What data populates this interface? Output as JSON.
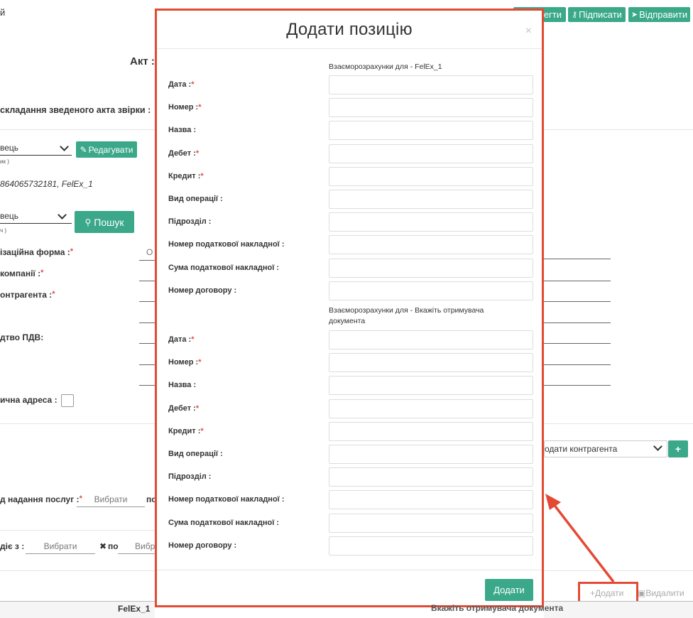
{
  "header": {
    "partial_left": "й",
    "partial_btn1": "егти",
    "sign_label": "Підписати",
    "send_label": "Відправити",
    "act_title": "Акт :"
  },
  "form": {
    "compile_label": "складання зведеного акта звірки :",
    "party_select_value": "вець",
    "party_select_hint": "ик )",
    "edit_label": "Редагувати",
    "org_info": "864065732181, FelEx_1",
    "party2_select_value": "вець",
    "party2_select_hint": "ч )",
    "search_label": "Пошук",
    "org_form_label": "ізаційна форма :",
    "org_form_value_partial": "О",
    "company_label": "компанії :",
    "contragent_label": "онтрагента :",
    "vat_label": "дтво ПДВ:",
    "address_label": "ична адреса :",
    "add_contragent_placeholder": "одати контрагента",
    "services_period_label": "д надання послуг :",
    "pick_placeholder": "Вибрати",
    "to_label_partial": "по",
    "valid_from_label": "діє з :",
    "valid_to_label": "по",
    "pick_partial": "Вибр",
    "add_link": "Додати",
    "delete_link": "Видалити"
  },
  "table": {
    "left_header": "FelEx_1",
    "right_header": "Вкажіть отримувача документа"
  },
  "modal": {
    "title": "Додати позицію",
    "close_icon": "×",
    "section1_title": "Взаєморозрахунки для - FelEx_1",
    "section2_title": "Взаєморозрахунки для - Вкажіть отримувача документа",
    "fields1": [
      {
        "label": "Дата :",
        "required": "*"
      },
      {
        "label": "Номер :",
        "required": "*"
      },
      {
        "label": "Назва :",
        "required": ""
      },
      {
        "label": "Дебет :",
        "required": "*"
      },
      {
        "label": "Кредит :",
        "required": "*"
      },
      {
        "label": "Вид операції :",
        "required": ""
      },
      {
        "label": "Підрозділ :",
        "required": ""
      },
      {
        "label": "Номер податкової накладної :",
        "required": ""
      },
      {
        "label": "Сума податкової накладної :",
        "required": ""
      },
      {
        "label": "Номер договору :",
        "required": ""
      }
    ],
    "fields2": [
      {
        "label": "Дата :",
        "required": "*"
      },
      {
        "label": "Номер :",
        "required": "*"
      },
      {
        "label": "Назва :",
        "required": ""
      },
      {
        "label": "Дебет :",
        "required": "*"
      },
      {
        "label": "Кредит :",
        "required": "*"
      },
      {
        "label": "Вид операції :",
        "required": ""
      },
      {
        "label": "Підрозділ :",
        "required": ""
      },
      {
        "label": "Номер податкової накладної :",
        "required": ""
      },
      {
        "label": "Сума податкової накладної :",
        "required": ""
      },
      {
        "label": "Номер договору :",
        "required": ""
      }
    ],
    "submit_label": "Додати"
  },
  "colors": {
    "accent": "#3aa889",
    "annotation": "#e34a34",
    "required": "#d9534f"
  }
}
